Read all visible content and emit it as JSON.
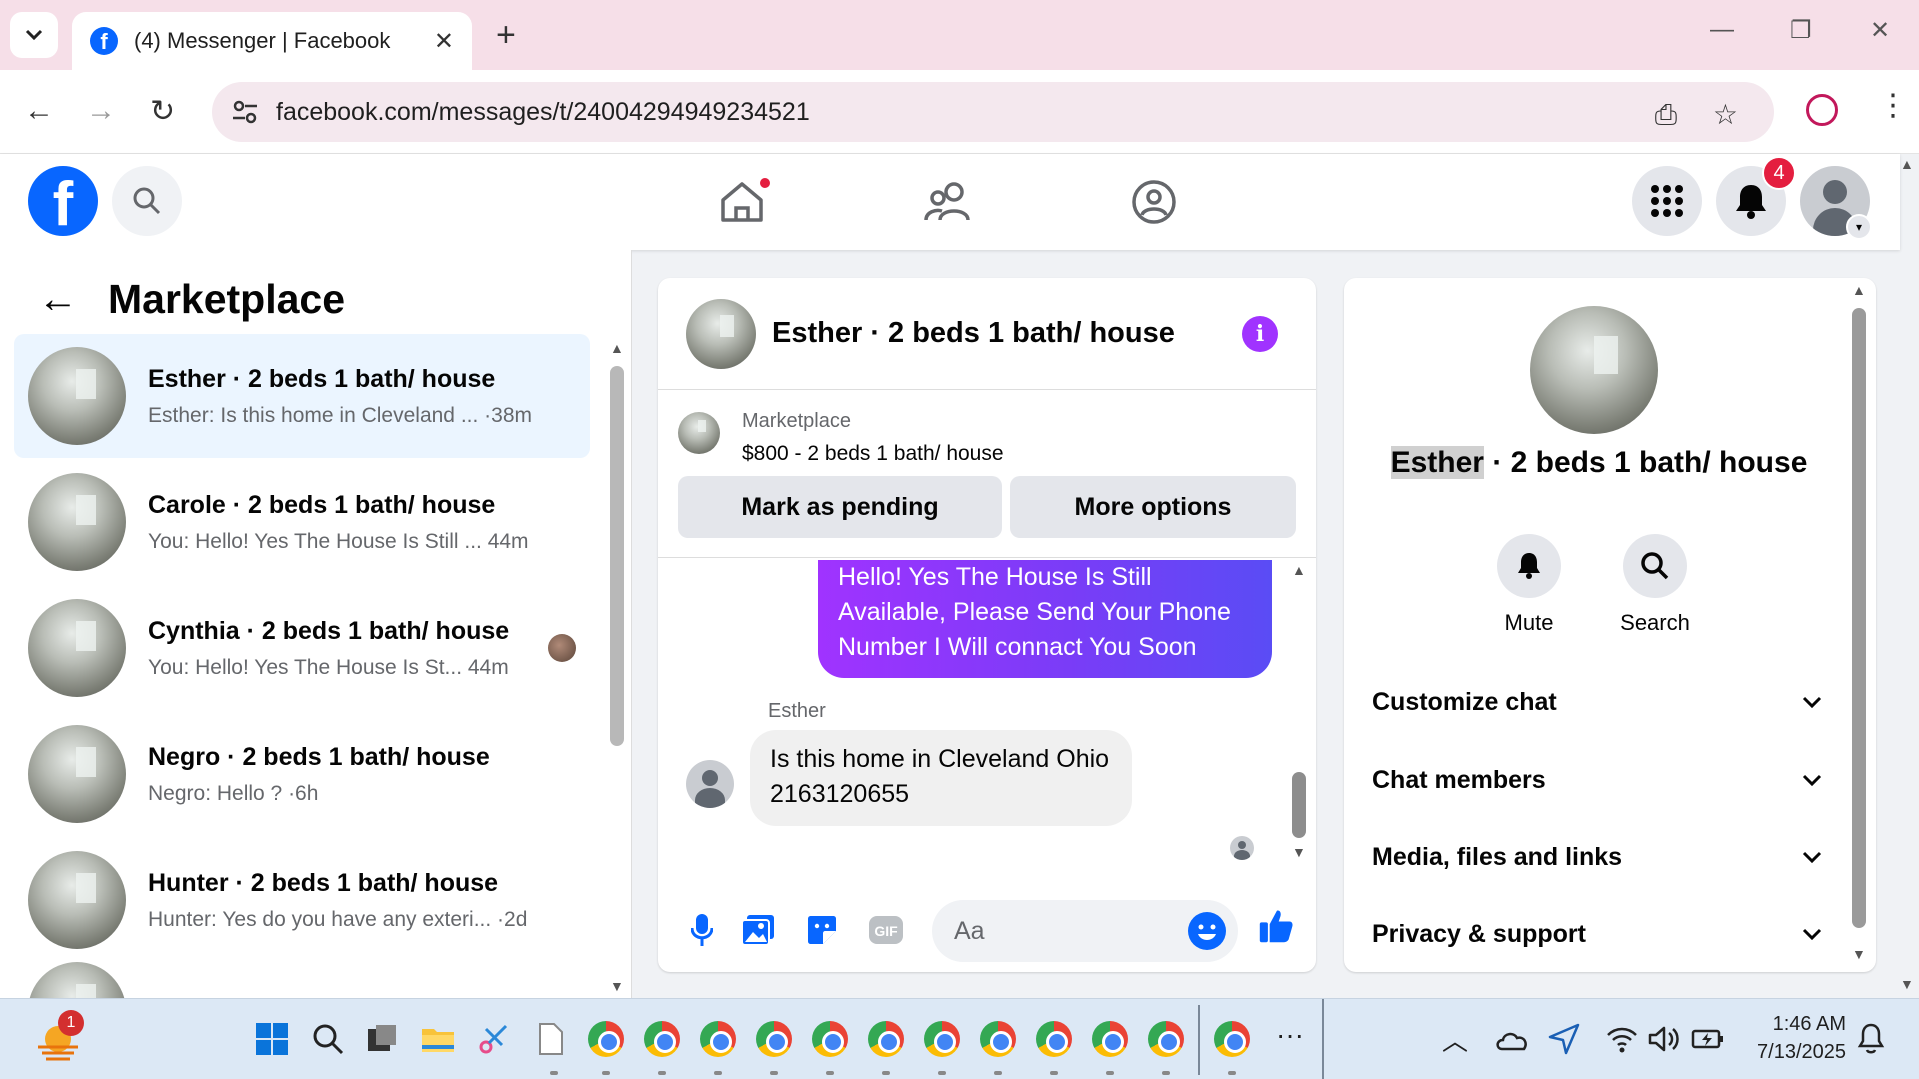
{
  "browser": {
    "tab_title": "(4) Messenger | Facebook",
    "url_domain": "facebook.com",
    "url_path": "/messages/t/24004294949234521"
  },
  "header": {
    "notification_count": "4",
    "icons": [
      "facebook-logo",
      "search-icon",
      "home-icon",
      "friends-icon",
      "groups-icon",
      "menu-grid-icon",
      "bell-icon",
      "profile-avatar"
    ]
  },
  "left_panel": {
    "title": "Marketplace",
    "conversations": [
      {
        "name": "Esther · 2 beds 1 bath/ house",
        "preview": "Esther: Is this home in Cleveland ... ·38m",
        "active": true
      },
      {
        "name": "Carole · 2 beds 1 bath/ house",
        "preview": "You: Hello! Yes The House Is Still ... 44m"
      },
      {
        "name": "Cynthia · 2 beds 1 bath/ house",
        "preview": "You: Hello! Yes The House Is St... 44m"
      },
      {
        "name": "Negro · 2 beds 1 bath/ house",
        "preview": "Negro: Hello ? ·6h"
      },
      {
        "name": "Hunter · 2 beds 1 bath/ house",
        "preview": "Hunter: Yes do you have any exteri... ·2d"
      }
    ]
  },
  "chat": {
    "title": "Esther · 2 beds 1 bath/ house",
    "listing_label": "Marketplace",
    "listing_price": "$800 - 2 beds 1 bath/ house",
    "mark_pending": "Mark as pending",
    "more_options": "More options",
    "outgoing_message": "Hello! Yes The House  Is Still Available, Please Send Your Phone Number I Will connact You Soon",
    "sender_name": "Esther",
    "incoming_message": "Is this home in Cleveland Ohio 2163120655",
    "composer_placeholder": "Aa"
  },
  "right_panel": {
    "title_name": "Esther",
    "title_rest": " · 2 beds 1 bath/ house",
    "mute": "Mute",
    "search": "Search",
    "sections": [
      "Customize chat",
      "Chat members",
      "Media, files and links",
      "Privacy & support"
    ]
  },
  "taskbar": {
    "weather_badge": "1",
    "time": "1:46 AM",
    "date": "7/13/2025"
  },
  "colors": {
    "facebook_blue": "#0866ff",
    "messenger_purple": "#a033ff",
    "notification_red": "#e41e3f"
  }
}
